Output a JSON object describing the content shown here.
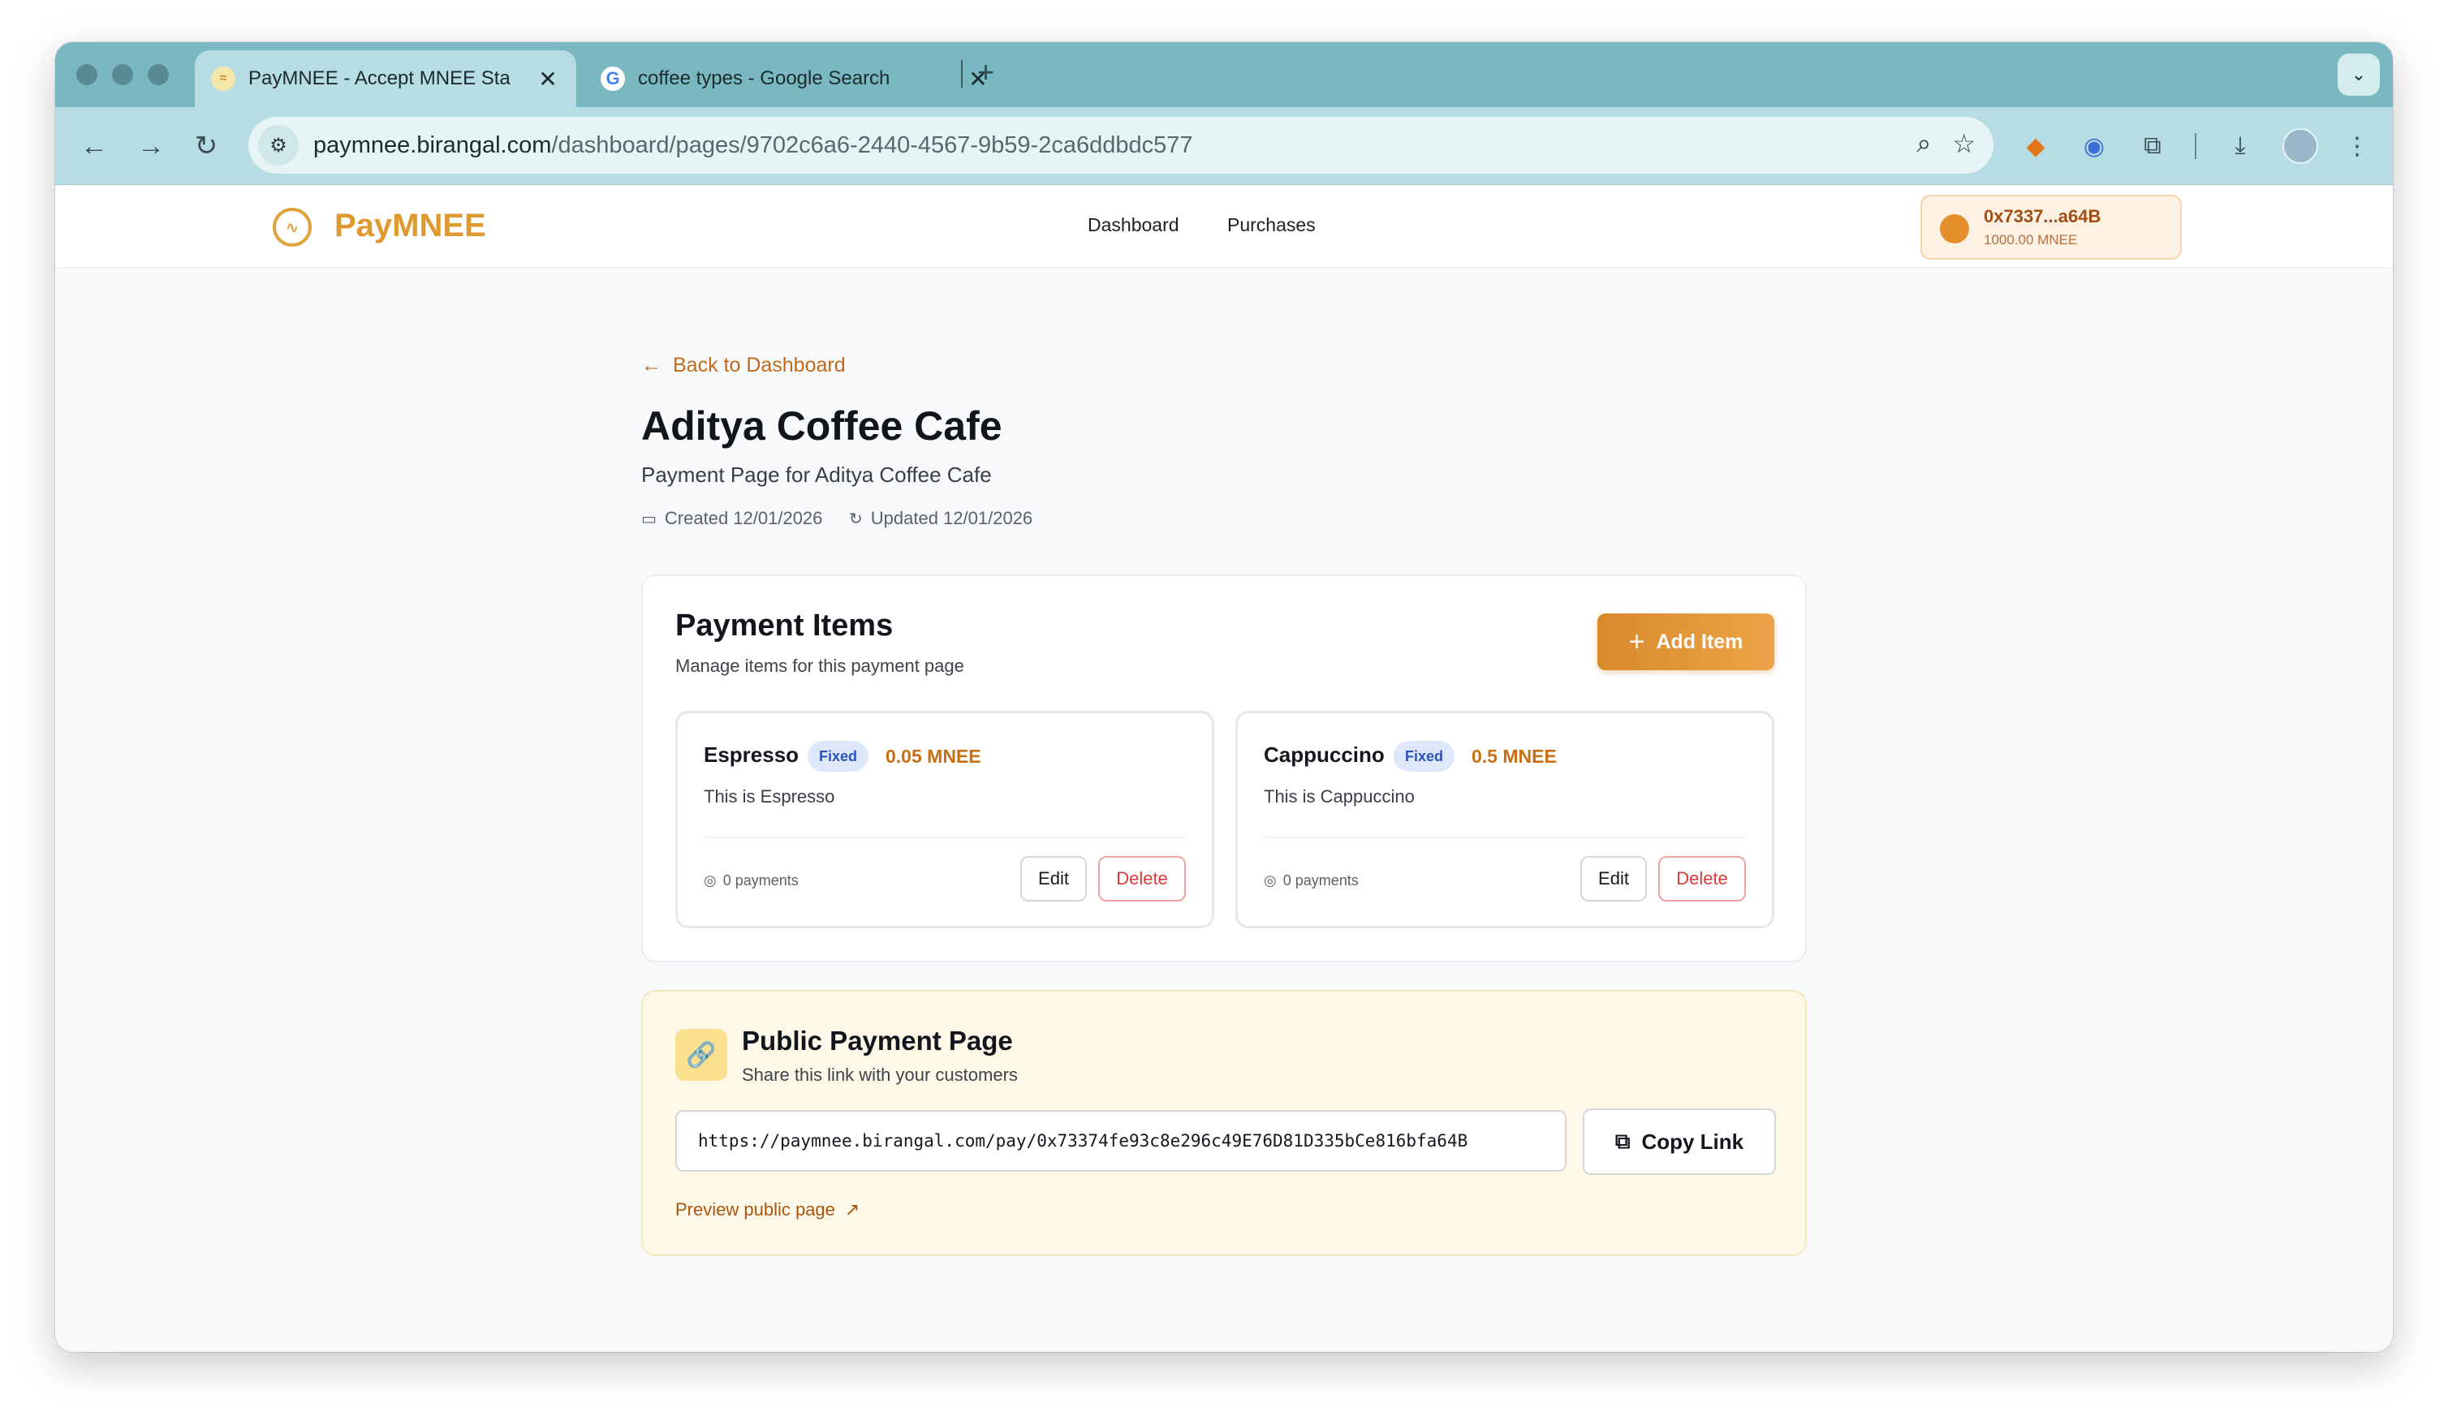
{
  "browser": {
    "tabs": [
      {
        "title": "PayMNEE - Accept MNEE Sta",
        "icon": "paymnee-favicon"
      },
      {
        "title": "coffee types - Google Search",
        "icon": "google-favicon"
      }
    ],
    "new_tab_glyph": "+",
    "close_glyph": "✕",
    "url_domain": "paymnee.birangal.com",
    "url_path": "/dashboard/pages/9702c6a6-2440-4567-9b59-2ca6ddbdc577"
  },
  "site": {
    "brand": "PayMNEE",
    "nav": [
      "Dashboard",
      "Purchases"
    ],
    "wallet": {
      "address": "0x7337...a64B",
      "balance": "1000.00 MNEE"
    }
  },
  "page": {
    "back_label": "Back to Dashboard",
    "title": "Aditya Coffee Cafe",
    "description": "Payment Page for Aditya Coffee Cafe",
    "created": "Created 12/01/2026",
    "updated": "Updated 12/01/2026"
  },
  "payment_items": {
    "title": "Payment Items",
    "subtitle": "Manage items for this payment page",
    "add_label": "Add Item",
    "items": [
      {
        "name": "Espresso",
        "badge": "Fixed",
        "price": "0.05 MNEE",
        "description": "This is Espresso",
        "payments": "0 payments",
        "edit_label": "Edit",
        "delete_label": "Delete"
      },
      {
        "name": "Cappuccino",
        "badge": "Fixed",
        "price": "0.5 MNEE",
        "description": "This is Cappuccino",
        "payments": "0 payments",
        "edit_label": "Edit",
        "delete_label": "Delete"
      }
    ]
  },
  "public_page": {
    "title": "Public Payment Page",
    "subtitle": "Share this link with your customers",
    "url": "https://paymnee.birangal.com/pay/0x73374fe93c8e296c49E76D81D335bCe816bfa64B",
    "copy_label": "Copy Link",
    "preview_label": "Preview public page"
  },
  "colors": {
    "accent": "#e0992f",
    "tab_strip": "#79b8c1",
    "toolbar": "#b6dde3",
    "danger": "#d83a3a",
    "badge_blue": "#2c53b8"
  }
}
